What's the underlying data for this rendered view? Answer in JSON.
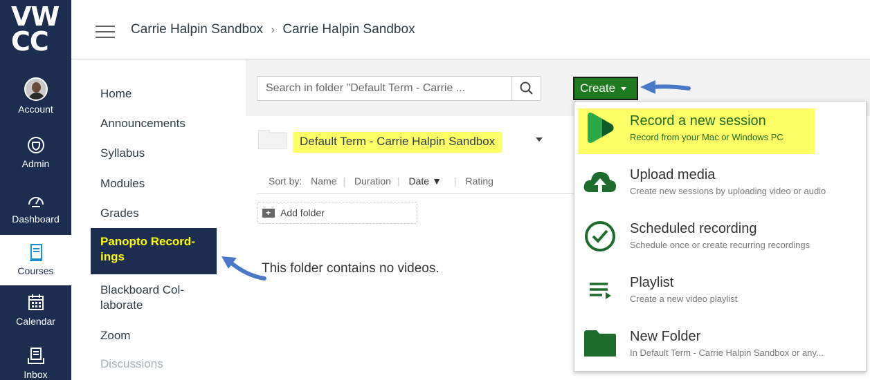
{
  "global_nav": {
    "logo": "VWCC",
    "logo_line1": "VW",
    "logo_line2": "CC",
    "items": [
      {
        "label": "Account"
      },
      {
        "label": "Admin"
      },
      {
        "label": "Dashboard"
      },
      {
        "label": "Courses"
      },
      {
        "label": "Calendar"
      },
      {
        "label": "Inbox"
      }
    ]
  },
  "header": {
    "breadcrumb": [
      "Carrie Halpin Sandbox",
      "Carrie Halpin Sandbox"
    ],
    "separator": "›"
  },
  "course_nav": {
    "items": [
      {
        "label": "Home"
      },
      {
        "label": "Announcements"
      },
      {
        "label": "Syllabus"
      },
      {
        "label": "Modules"
      },
      {
        "label": "Grades"
      },
      {
        "label": "Panopto Record-\nings"
      },
      {
        "label": "Blackboard Col-\nlaborate"
      },
      {
        "label": "Zoom"
      },
      {
        "label": "Discussions"
      }
    ],
    "active_label_line1": "Panopto Record-",
    "active_label_line2": "ings",
    "blackboard_line1": "Blackboard Col-",
    "blackboard_line2": "laborate"
  },
  "panopto": {
    "search_placeholder": "Search in folder \"Default Term - Carrie ...",
    "create_label": "Create",
    "folder_name": "Default Term - Carrie Halpin Sandbox",
    "sort": {
      "label": "Sort by:",
      "options": [
        "Name",
        "Duration",
        "Date",
        "Rating"
      ],
      "active": "Date"
    },
    "add_folder_label": "Add folder",
    "empty_message": "This folder contains no videos."
  },
  "create_menu": {
    "items": [
      {
        "title": "Record a new session",
        "subtitle": "Record from your Mac or Windows PC"
      },
      {
        "title": "Upload media",
        "subtitle": "Create new sessions by uploading video or audio"
      },
      {
        "title": "Scheduled recording",
        "subtitle": "Schedule once or create recurring recordings"
      },
      {
        "title": "Playlist",
        "subtitle": "Create a new video playlist"
      },
      {
        "title": "New Folder",
        "subtitle": "In Default Term - Carrie Halpin Sandbox or any..."
      }
    ]
  },
  "colors": {
    "nav_bg": "#1d2d4f",
    "panopto_green": "#1e7a1e",
    "highlight": "#ffff66",
    "annotation_arrow": "#4a78c8"
  }
}
